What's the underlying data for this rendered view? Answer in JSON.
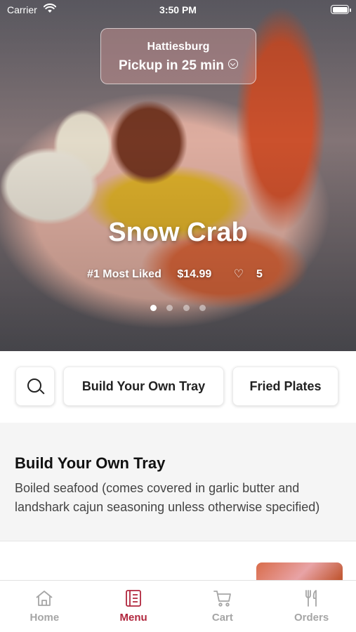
{
  "status_bar": {
    "carrier": "Carrier",
    "time": "3:50 PM"
  },
  "location": {
    "city": "Hattiesburg",
    "pickup": "Pickup in 25 min"
  },
  "hero": {
    "title": "Snow Crab",
    "badge": "#1 Most Liked",
    "price": "$14.99",
    "likes": "5",
    "slide_count": 4,
    "active_slide": 1
  },
  "categories": {
    "build": "Build Your Own Tray",
    "fried": "Fried Plates"
  },
  "section": {
    "title": "Build Your Own Tray",
    "description": "Boiled seafood (comes covered in garlic butter and landshark cajun seasoning unless otherwise specified)"
  },
  "tabs": [
    {
      "label": "Home",
      "icon": "home-icon",
      "active": false
    },
    {
      "label": "Menu",
      "icon": "menu-icon",
      "active": true
    },
    {
      "label": "Cart",
      "icon": "cart-icon",
      "active": false
    },
    {
      "label": "Orders",
      "icon": "fork-knife-icon",
      "active": false
    }
  ],
  "colors": {
    "accent": "#b0263d",
    "inactive": "#a6a6a6"
  }
}
